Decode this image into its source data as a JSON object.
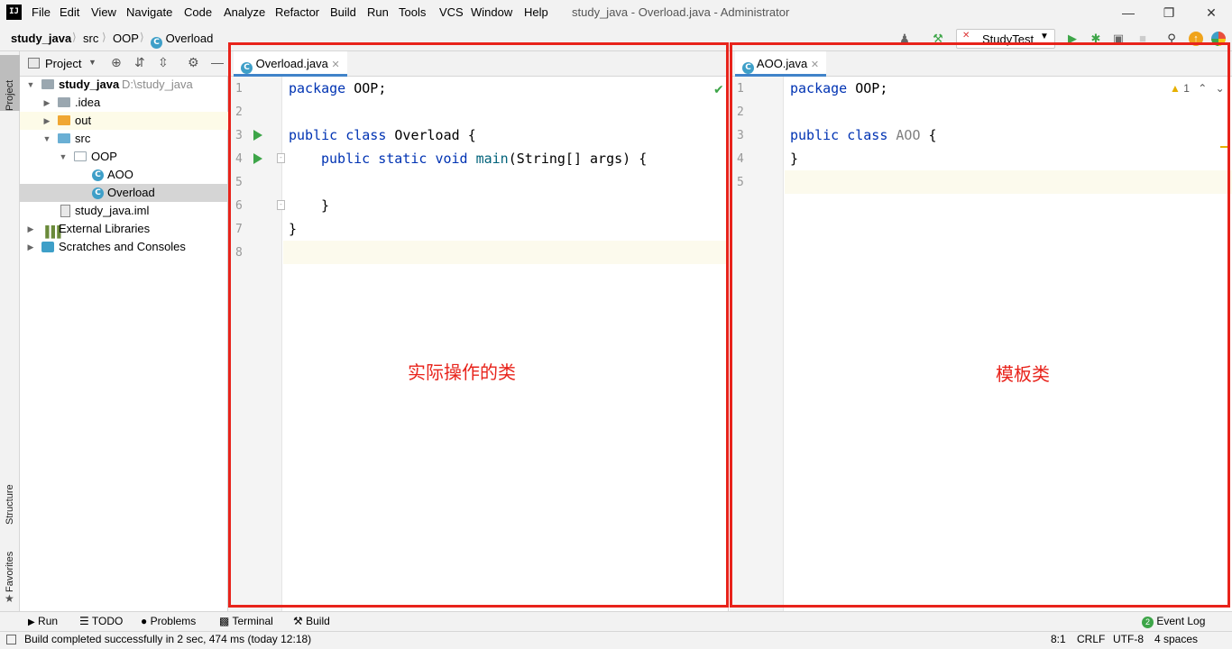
{
  "menubar": {
    "logo": "IJ",
    "items": [
      "File",
      "Edit",
      "View",
      "Navigate",
      "Code",
      "Analyze",
      "Refactor",
      "Build",
      "Run",
      "Tools",
      "VCS",
      "Window",
      "Help"
    ],
    "window_title": "study_java - Overload.java - Administrator"
  },
  "breadcrumb": [
    "study_java",
    "src",
    "OOP",
    "Overload"
  ],
  "toolbar": {
    "run_config": "StudyTest"
  },
  "side_tabs": {
    "project": "Project",
    "structure": "Structure",
    "favorites": "Favorites"
  },
  "project": {
    "header": "Project",
    "tree": [
      {
        "label": "study_java",
        "extra": "D:\\study_java"
      },
      {
        "label": ".idea"
      },
      {
        "label": "out"
      },
      {
        "label": "src"
      },
      {
        "label": "OOP"
      },
      {
        "label": "AOO"
      },
      {
        "label": "Overload"
      },
      {
        "label": "study_java.iml"
      },
      {
        "label": "External Libraries"
      },
      {
        "label": "Scratches and Consoles"
      }
    ]
  },
  "editor_left": {
    "tab": "Overload.java",
    "line_numbers": [
      "1",
      "2",
      "3",
      "4",
      "5",
      "6",
      "7",
      "8"
    ],
    "annotation": "实际操作的类"
  },
  "editor_right": {
    "tab": "AOO.java",
    "line_numbers": [
      "1",
      "2",
      "3",
      "4",
      "5"
    ],
    "warning_count": "1",
    "annotation": "模板类"
  },
  "bottom_tabs": [
    "Run",
    "TODO",
    "Problems",
    "Terminal",
    "Build"
  ],
  "event_log": {
    "count": "2",
    "label": "Event Log"
  },
  "status": {
    "message": "Build completed successfully in 2 sec, 474 ms (today 12:18)",
    "position": "8:1",
    "line_sep": "CRLF",
    "encoding": "UTF-8",
    "indent": "4 spaces"
  },
  "code": {
    "kw_package": "package",
    "pkg_name": "OOP;",
    "kw_public": "public",
    "kw_class": "class",
    "kw_static": "static",
    "kw_void": "void",
    "cls_overload": "Overload",
    "cls_aoo": "AOO",
    "fn_main": "main",
    "params": "(String[] args) {",
    "open_brace": "{",
    "close_brace": "}"
  },
  "colors": {
    "accent": "#4083c9",
    "annotation": "#e8231b",
    "run_green": "#3da548"
  }
}
